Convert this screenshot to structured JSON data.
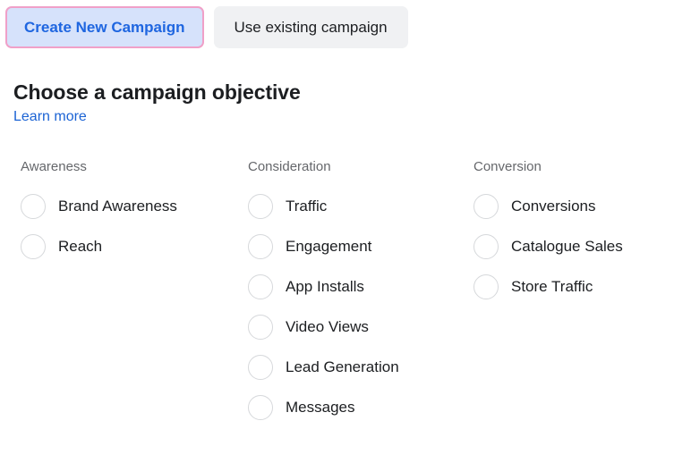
{
  "tabs": [
    {
      "label": "Create New Campaign",
      "active": true
    },
    {
      "label": "Use existing campaign",
      "active": false
    }
  ],
  "section": {
    "heading": "Choose a campaign objective",
    "learn_more_label": "Learn more"
  },
  "colors": {
    "active_tab_text": "#1f66e0",
    "active_tab_background": "#d6e2fb",
    "active_tab_border": "#f0a0c8",
    "inactive_tab_background": "#f0f1f3",
    "link": "#1b63d4",
    "column_header_text": "#65676b",
    "option_label_text": "#1c1e21",
    "radio_border": "#d6d8db",
    "page_background": "#ffffff"
  },
  "columns": [
    {
      "header": "Awareness",
      "options": [
        {
          "label": "Brand Awareness",
          "selected": false
        },
        {
          "label": "Reach",
          "selected": false
        }
      ]
    },
    {
      "header": "Consideration",
      "options": [
        {
          "label": "Traffic",
          "selected": false
        },
        {
          "label": "Engagement",
          "selected": false
        },
        {
          "label": "App Installs",
          "selected": false
        },
        {
          "label": "Video Views",
          "selected": false
        },
        {
          "label": "Lead Generation",
          "selected": false
        },
        {
          "label": "Messages",
          "selected": false
        }
      ]
    },
    {
      "header": "Conversion",
      "options": [
        {
          "label": "Conversions",
          "selected": false
        },
        {
          "label": "Catalogue Sales",
          "selected": false
        },
        {
          "label": "Store Traffic",
          "selected": false
        }
      ]
    }
  ]
}
